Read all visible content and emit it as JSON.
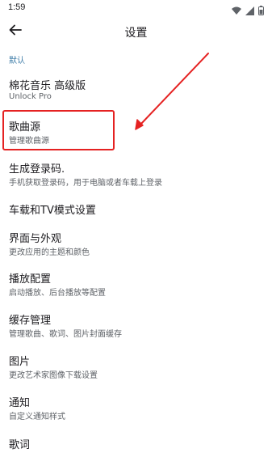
{
  "status_bar": {
    "time": "1:59",
    "icons": [
      "wifi-icon",
      "signal-icon",
      "battery-icon"
    ]
  },
  "app_bar": {
    "title": "设置",
    "back_icon": "arrow-back-icon"
  },
  "section_header": "默认",
  "items": [
    {
      "title": "棉花音乐 高级版",
      "subtitle": "Unlock Pro"
    },
    {
      "title": "歌曲源",
      "subtitle": "管理歌曲源"
    },
    {
      "title": "生成登录码.",
      "subtitle": "手机获取登录码，用于电脑或者车载上登录"
    },
    {
      "title": "车载和TV模式设置",
      "subtitle": ""
    },
    {
      "title": "界面与外观",
      "subtitle": "更改应用的主题和颜色"
    },
    {
      "title": "播放配置",
      "subtitle": "启动播放、后台播放等配置"
    },
    {
      "title": "缓存管理",
      "subtitle": "管理歌曲、歌词、图片封面缓存"
    },
    {
      "title": "图片",
      "subtitle": "更改艺术家图像下载设置"
    },
    {
      "title": "通知",
      "subtitle": "自定义通知样式"
    },
    {
      "title": "歌词",
      "subtitle": ""
    }
  ],
  "colors": {
    "accent": "#3f7da8",
    "annotation": "#e52222"
  }
}
